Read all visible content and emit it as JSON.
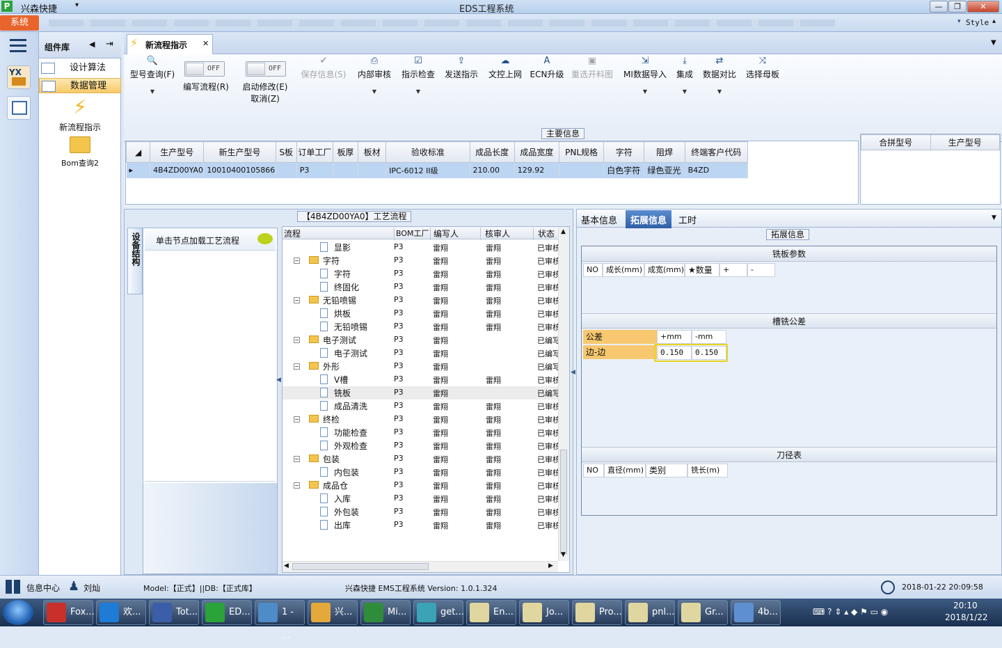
{
  "titlebar": {
    "app_name": "兴森快捷",
    "window_title": "EDS工程系统",
    "minimize": "—",
    "maximize": "❐",
    "close": "✕"
  },
  "menubar": {
    "system": "系统",
    "style": "Style"
  },
  "component_panel": {
    "title": "组件库",
    "items": [
      {
        "label": "设计算法"
      },
      {
        "label": "数据管理"
      }
    ],
    "big_items": [
      {
        "label": "新流程指示"
      },
      {
        "label": "Bom查询2"
      }
    ]
  },
  "tab": {
    "label": "新流程指示"
  },
  "toolbar": {
    "model_query": "型号查询(F)",
    "edit_flow_toggle": "OFF",
    "edit_flow": "编写流程(R)",
    "start_modify_toggle": "OFF",
    "start_modify": "启动修改(E)",
    "cancel": "取消(Z)",
    "save": "保存信息(S)",
    "internal_review": "内部审核",
    "check": "指示检查",
    "send": "发送指示",
    "upload": "文控上网",
    "ecn": "ECN升级",
    "reselect": "重选开料图",
    "mi_import": "MI数据导入",
    "integrate": "集成",
    "compare": "数据对比",
    "mother_board": "选择母板"
  },
  "main_info": {
    "label": "主要信息",
    "columns": [
      "生产型号",
      "新生产型号",
      "S板",
      "订单工厂",
      "板厚",
      "板材",
      "验收标准",
      "成品长度",
      "成品宽度",
      "PNL规格",
      "字符",
      "阻焊",
      "终端客户代码"
    ],
    "row": [
      "4B4ZD00YA0",
      "10010400105866",
      "",
      "P3",
      "",
      "",
      "IPC-6012 II级",
      "210.00",
      "129.92",
      "",
      "白色字符",
      "绿色亚光",
      "B4ZD"
    ],
    "side_columns": [
      "合拼型号",
      "生产型号"
    ]
  },
  "process": {
    "label": "【4B4ZD00YA0】工艺流程",
    "side_tab": "设备结构",
    "hint": "单击节点加载工艺流程",
    "columns": [
      "流程",
      "BOM工厂",
      "编写人",
      "核审人",
      "状态"
    ],
    "rows": [
      {
        "name": "显影",
        "f": "P3",
        "w": "雷翔",
        "r": "雷翔",
        "s": "已审核"
      },
      {
        "name": "字符",
        "f": "P3",
        "w": "雷翔",
        "r": "雷翔",
        "s": "已审核"
      },
      {
        "name": "字符",
        "f": "P3",
        "w": "雷翔",
        "r": "雷翔",
        "s": "已审核"
      },
      {
        "name": "终固化",
        "f": "P3",
        "w": "雷翔",
        "r": "雷翔",
        "s": "已审核"
      },
      {
        "name": "无铅喷锡",
        "f": "P3",
        "w": "雷翔",
        "r": "雷翔",
        "s": "已审核"
      },
      {
        "name": "烘板",
        "f": "P3",
        "w": "雷翔",
        "r": "雷翔",
        "s": "已审核"
      },
      {
        "name": "无铅喷锡",
        "f": "P3",
        "w": "雷翔",
        "r": "雷翔",
        "s": "已审核"
      },
      {
        "name": "电子测试",
        "f": "P3",
        "w": "雷翔",
        "r": "",
        "s": "已编写"
      },
      {
        "name": "电子测试",
        "f": "P3",
        "w": "雷翔",
        "r": "",
        "s": "已编写"
      },
      {
        "name": "外形",
        "f": "P3",
        "w": "雷翔",
        "r": "",
        "s": "已编写"
      },
      {
        "name": "V槽",
        "f": "P3",
        "w": "雷翔",
        "r": "雷翔",
        "s": "已审核"
      },
      {
        "name": "铣板",
        "f": "P3",
        "w": "雷翔",
        "r": "",
        "s": "已编写"
      },
      {
        "name": "成品清洗",
        "f": "P3",
        "w": "雷翔",
        "r": "雷翔",
        "s": "已审核"
      },
      {
        "name": "终检",
        "f": "P3",
        "w": "雷翔",
        "r": "雷翔",
        "s": "已审核"
      },
      {
        "name": "功能检查",
        "f": "P3",
        "w": "雷翔",
        "r": "雷翔",
        "s": "已审核"
      },
      {
        "name": "外观检查",
        "f": "P3",
        "w": "雷翔",
        "r": "雷翔",
        "s": "已审核"
      },
      {
        "name": "包装",
        "f": "P3",
        "w": "雷翔",
        "r": "雷翔",
        "s": "已审核"
      },
      {
        "name": "内包装",
        "f": "P3",
        "w": "雷翔",
        "r": "雷翔",
        "s": "已审核"
      },
      {
        "name": "成品仓",
        "f": "P3",
        "w": "雷翔",
        "r": "雷翔",
        "s": "已审核"
      },
      {
        "name": "入库",
        "f": "P3",
        "w": "雷翔",
        "r": "雷翔",
        "s": "已审核"
      },
      {
        "name": "外包装",
        "f": "P3",
        "w": "雷翔",
        "r": "雷翔",
        "s": "已审核"
      },
      {
        "name": "出库",
        "f": "P3",
        "w": "雷翔",
        "r": "雷翔",
        "s": "已审核"
      }
    ]
  },
  "right_panel": {
    "tabs": [
      "基本信息",
      "拓展信息",
      "工时"
    ],
    "ext_label": "拓展信息",
    "mill_title": "铣板参数",
    "mill_cols": [
      "NO",
      "成长(mm)",
      "成宽(mm)",
      "★数量",
      "+",
      "-"
    ],
    "tol_title": "槽铣公差",
    "tol_label": "公差",
    "plus_mm": "+mm",
    "minus_mm": "-mm",
    "edge_label": "边-边",
    "edge_plus": "0.150",
    "edge_minus": "0.150",
    "tool_title": "刀径表",
    "tool_cols": [
      "NO",
      "直径(mm)",
      "类别",
      "铣长(m)"
    ]
  },
  "statusbar": {
    "info_center": "信息中心",
    "user": "刘灿",
    "model_db": "Model:【正式】||DB:【正式库】",
    "version": "兴森快捷 EMS工程系统 Version: 1.0.1.324",
    "datetime": "2018-01-22 20:09:58"
  },
  "taskbar": {
    "items": [
      "Fox...",
      "欢...",
      "Tot...",
      "ED...",
      "1 - ...",
      "兴...",
      "Mi...",
      "get...",
      "En...",
      "Jo...",
      "Pro...",
      "pnl...",
      "Gr...",
      "4b..."
    ],
    "time": "20:10",
    "date": "2018/1/22"
  }
}
